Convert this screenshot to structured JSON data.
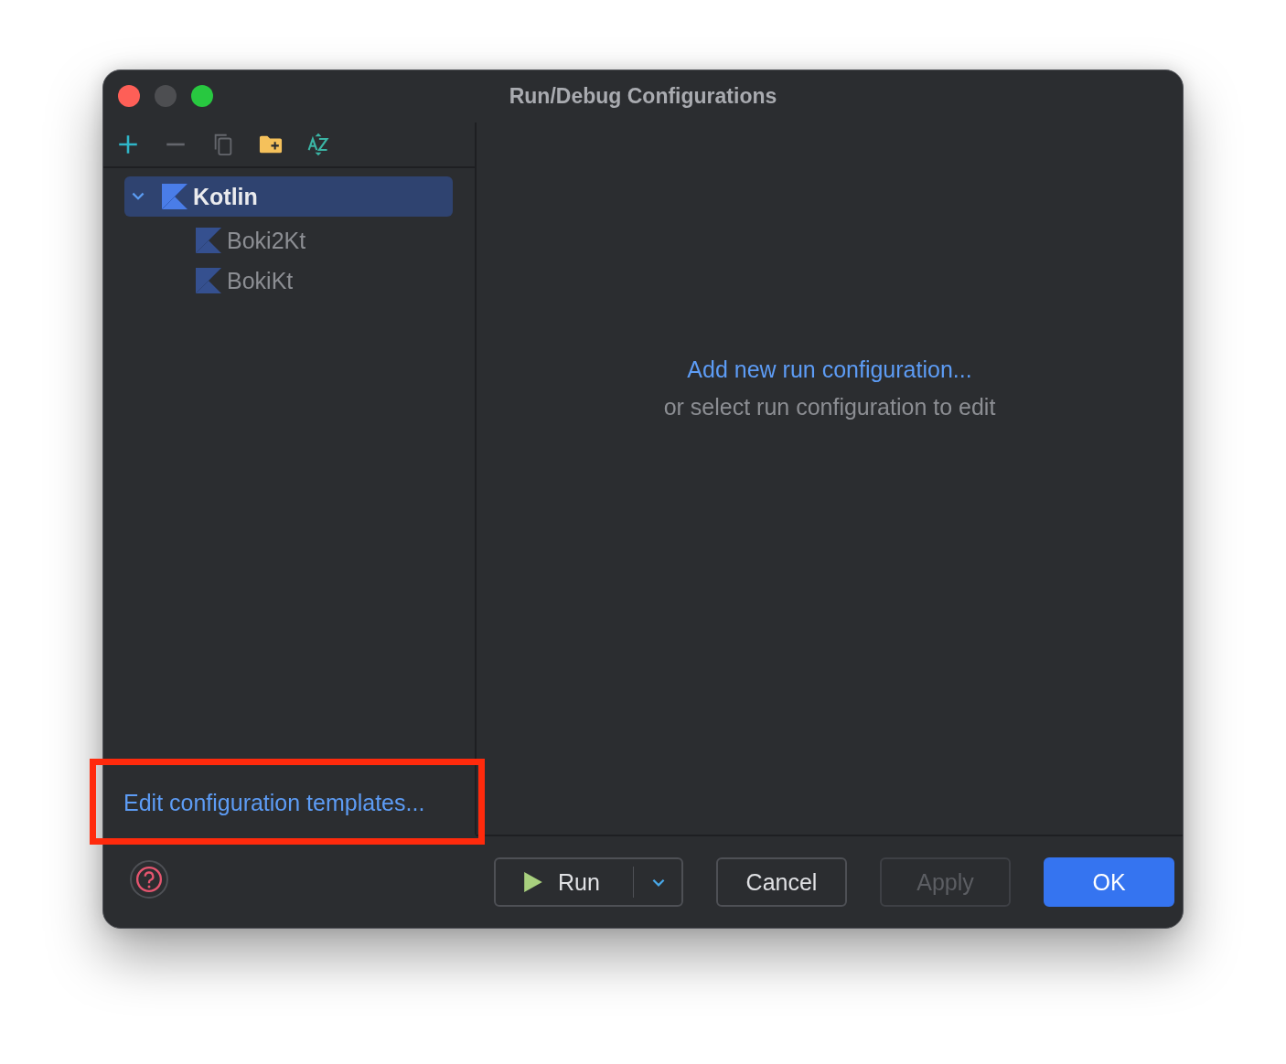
{
  "window": {
    "title": "Run/Debug Configurations"
  },
  "toolbar": {
    "items": [
      {
        "kind": "add",
        "disabled": false
      },
      {
        "kind": "remove",
        "disabled": true
      },
      {
        "kind": "copy",
        "disabled": true
      },
      {
        "kind": "folder",
        "disabled": false
      },
      {
        "kind": "sort",
        "disabled": false
      }
    ]
  },
  "tree": [
    {
      "label": "Kotlin",
      "selected": true,
      "expanded": true,
      "children": [
        {
          "label": "Boki2Kt",
          "selected": false
        },
        {
          "label": "BokiKt",
          "selected": false
        }
      ]
    }
  ],
  "templates_link": "Edit configuration templates...",
  "empty_state": {
    "link": "Add new run configuration...",
    "hint": "or select run configuration to edit"
  },
  "buttons": [
    {
      "label": "Run",
      "kind": "split",
      "disabled": false
    },
    {
      "label": "Cancel",
      "kind": "normal",
      "disabled": false
    },
    {
      "label": "Apply",
      "kind": "normal",
      "disabled": true
    },
    {
      "label": "OK",
      "kind": "primary",
      "disabled": false
    }
  ]
}
